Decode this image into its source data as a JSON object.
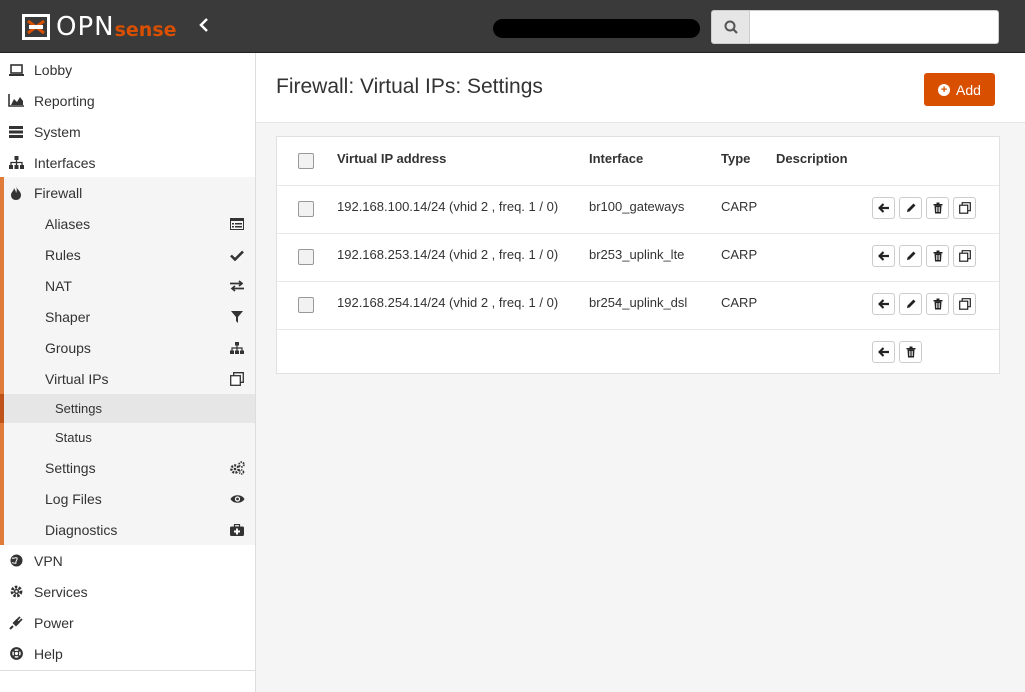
{
  "header": {
    "logo_text": "OPN",
    "logo_text2": "sense",
    "collapse_icon": "chevron-left-icon",
    "search": {
      "placeholder": "",
      "value": ""
    }
  },
  "sidebar": {
    "items": [
      {
        "label": "Lobby",
        "icon": "laptop-icon"
      },
      {
        "label": "Reporting",
        "icon": "area-chart-icon"
      },
      {
        "label": "System",
        "icon": "server-icon"
      },
      {
        "label": "Interfaces",
        "icon": "sitemap-icon"
      },
      {
        "label": "Firewall",
        "icon": "fire-icon"
      }
    ],
    "firewall_sub": [
      {
        "label": "Aliases",
        "icon": "list-alt-icon"
      },
      {
        "label": "Rules",
        "icon": "check-icon"
      },
      {
        "label": "NAT",
        "icon": "exchange-icon"
      },
      {
        "label": "Shaper",
        "icon": "filter-icon"
      },
      {
        "label": "Groups",
        "icon": "sitemap-icon"
      },
      {
        "label": "Virtual IPs",
        "icon": "clone-icon"
      }
    ],
    "vip_sub": [
      {
        "label": "Settings"
      },
      {
        "label": "Status"
      }
    ],
    "firewall_sub2": [
      {
        "label": "Settings",
        "icon": "cogs-icon"
      },
      {
        "label": "Log Files",
        "icon": "eye-icon"
      },
      {
        "label": "Diagnostics",
        "icon": "medkit-icon"
      }
    ],
    "bottom_items": [
      {
        "label": "VPN",
        "icon": "globe-icon"
      },
      {
        "label": "Services",
        "icon": "cog-icon"
      },
      {
        "label": "Power",
        "icon": "plug-icon"
      },
      {
        "label": "Help",
        "icon": "life-ring-icon"
      }
    ]
  },
  "main": {
    "title": "Firewall: Virtual IPs: Settings",
    "add_label": "Add",
    "table": {
      "headers": [
        "Virtual IP address",
        "Interface",
        "Type",
        "Description"
      ],
      "rows": [
        {
          "address": "192.168.100.14/24 (vhid 2 , freq. 1 / 0)",
          "interface": "br100_gateways",
          "type": "CARP",
          "description": ""
        },
        {
          "address": "192.168.253.14/24 (vhid 2 , freq. 1 / 0)",
          "interface": "br253_uplink_lte",
          "type": "CARP",
          "description": ""
        },
        {
          "address": "192.168.254.14/24 (vhid 2 , freq. 1 / 0)",
          "interface": "br254_uplink_dsl",
          "type": "CARP",
          "description": ""
        }
      ]
    }
  },
  "colors": {
    "accent": "#d94f00",
    "topbar": "#3a3a3a",
    "firewall_bar": "#e07b39"
  }
}
